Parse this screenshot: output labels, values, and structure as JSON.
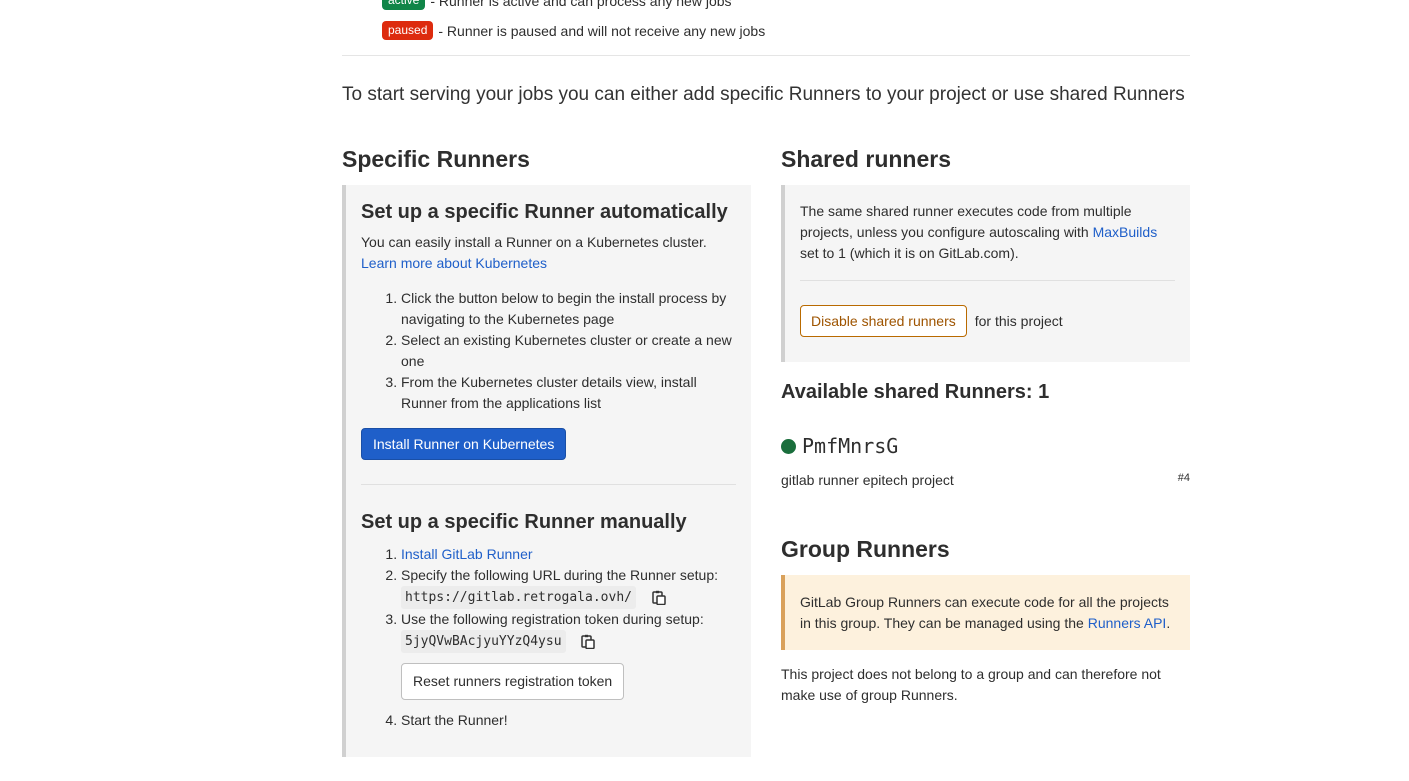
{
  "legend": {
    "active_badge": "active",
    "active_text": "- Runner is active and can process any new jobs",
    "paused_badge": "paused",
    "paused_text": "- Runner is paused and will not receive any new jobs"
  },
  "intro": "To start serving your jobs you can either add specific Runners to your project or use shared Runners",
  "specific": {
    "title": "Specific Runners",
    "auto": {
      "title": "Set up a specific Runner automatically",
      "desc": "You can easily install a Runner on a Kubernetes cluster.",
      "learn_link": "Learn more about Kubernetes",
      "steps": [
        "Click the button below to begin the install process by navigating to the Kubernetes page",
        "Select an existing Kubernetes cluster or create a new one",
        "From the Kubernetes cluster details view, install Runner from the applications list"
      ],
      "install_button": "Install Runner on Kubernetes"
    },
    "manual": {
      "title": "Set up a specific Runner manually",
      "step1_link": "Install GitLab Runner",
      "step2": "Specify the following URL during the Runner setup:",
      "url": "https://gitlab.retrogala.ovh/",
      "step3": "Use the following registration token during setup:",
      "token": "5jyQVwBAcjyuYYzQ4ysu",
      "reset_button": "Reset runners registration token",
      "step4": "Start the Runner!"
    }
  },
  "shared": {
    "title": "Shared runners",
    "desc_before": "The same shared runner executes code from multiple projects, unless you configure autoscaling with ",
    "maxbuilds_link": "MaxBuilds",
    "desc_after": " set to 1 (which it is on GitLab.com).",
    "disable_button": "Disable shared runners",
    "disable_suffix": "for this project",
    "available_title": "Available shared Runners: 1",
    "runner": {
      "name": "PmfMnrsG",
      "description": "gitlab runner epitech project",
      "id": "#4"
    }
  },
  "group": {
    "title": "Group Runners",
    "desc": "GitLab Group Runners can execute code for all the projects in this group. They can be managed using the ",
    "api_link": "Runners API",
    "desc_end": ".",
    "note": "This project does not belong to a group and can therefore not make use of group Runners."
  },
  "colors": {
    "active": "#108548",
    "paused": "#dd2b0e",
    "primary": "#1f5fc9",
    "warning_border": "#b96a00",
    "runner_online": "#1a6e3c"
  }
}
